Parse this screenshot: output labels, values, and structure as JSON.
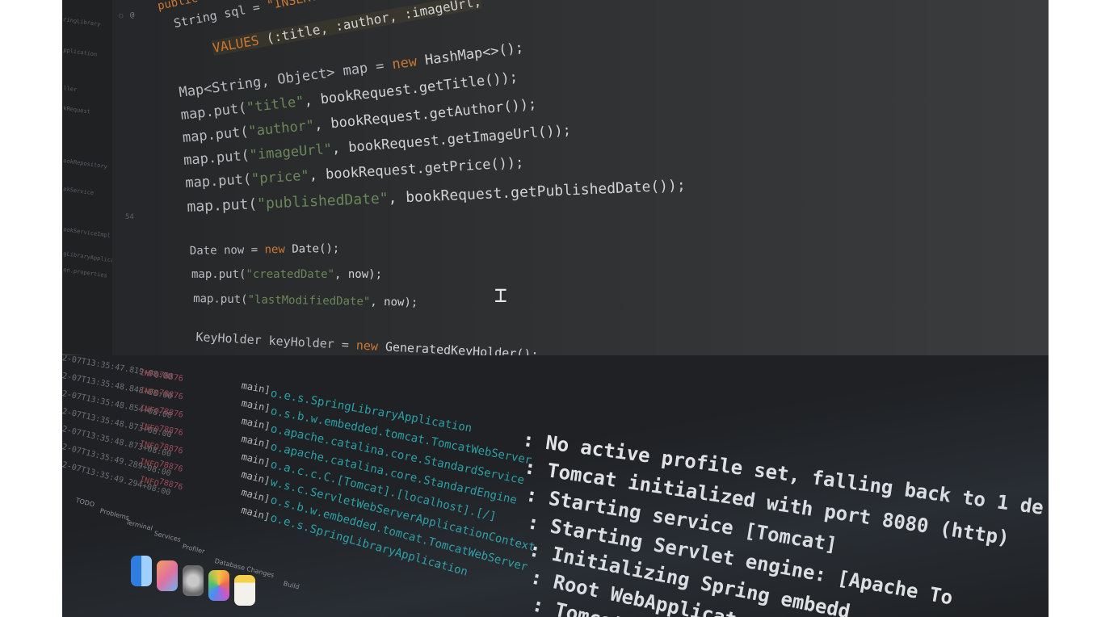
{
  "editor": {
    "sql_line": {
      "prefix": "public Integ",
      "decl": "String sql = ",
      "string": "\"INSERT INTO ",
      "rest": ":imageUrl,"
    },
    "values_line": {
      "kw": "VALUES",
      "text": " (:title, :author, :imageUrl,"
    },
    "gutter_line": "54",
    "lines": [
      {
        "parts": [
          {
            "t": "Map<String, Object> map = ",
            "c": "typ"
          },
          {
            "t": "new",
            "c": "kw"
          },
          {
            "t": " HashMap<>();",
            "c": "txt"
          }
        ]
      },
      {
        "parts": [
          {
            "t": "map.put(",
            "c": "typ"
          },
          {
            "t": "\"title\"",
            "c": "str"
          },
          {
            "t": ", bookRequest.getTitle());",
            "c": "txt"
          }
        ]
      },
      {
        "parts": [
          {
            "t": "map.put(",
            "c": "typ"
          },
          {
            "t": "\"author\"",
            "c": "str"
          },
          {
            "t": ", bookRequest.getAuthor());",
            "c": "txt"
          }
        ]
      },
      {
        "parts": [
          {
            "t": "map.put(",
            "c": "typ"
          },
          {
            "t": "\"imageUrl\"",
            "c": "str"
          },
          {
            "t": ", bookRequest.getImageUrl());",
            "c": "txt"
          }
        ]
      },
      {
        "parts": [
          {
            "t": "map.put(",
            "c": "typ"
          },
          {
            "t": "\"price\"",
            "c": "str"
          },
          {
            "t": ", bookRequest.getPrice());",
            "c": "txt"
          }
        ]
      },
      {
        "parts": [
          {
            "t": "map.put(",
            "c": "typ"
          },
          {
            "t": "\"publishedDate\"",
            "c": "str"
          },
          {
            "t": ", bookRequest.getPublishedDate());",
            "c": "txt"
          }
        ]
      },
      {
        "parts": [
          {
            "t": "Date now = ",
            "c": "typ"
          },
          {
            "t": "new",
            "c": "kw"
          },
          {
            "t": " Date();",
            "c": "txt"
          }
        ]
      },
      {
        "parts": [
          {
            "t": "map.put(",
            "c": "typ"
          },
          {
            "t": "\"createdDate\"",
            "c": "str"
          },
          {
            "t": ", now);",
            "c": "txt"
          }
        ]
      },
      {
        "parts": [
          {
            "t": "map.put(",
            "c": "typ"
          },
          {
            "t": "\"lastModifiedDate\"",
            "c": "str"
          },
          {
            "t": ", now);",
            "c": "txt"
          }
        ]
      },
      {
        "parts": [
          {
            "t": "KeyHolder keyHolder = ",
            "c": "typ"
          },
          {
            "t": "new",
            "c": "kw"
          },
          {
            "t": " GeneratedKeyHolder();",
            "c": "txt"
          }
        ]
      }
    ]
  },
  "project_tree": {
    "items": [
      "ringLibrary",
      "pplication",
      "ller",
      "kRequest",
      "ookRepository",
      "okService",
      "ookServiceImpl",
      "gLibraryApplication",
      "on.properties"
    ]
  },
  "console": {
    "rows": [
      {
        "ts": "2-07T13:35:47.819+08:00",
        "lvl": "INFO",
        "pid": "78876",
        "thread": "main]",
        "logger": "o.e.s.SpringLibraryApplication",
        "message": ": No active profile set, falling back to 1 de"
      },
      {
        "ts": "2-07T13:35:48.848+08:00",
        "lvl": "INFO",
        "pid": "78876",
        "thread": "main]",
        "logger": "o.s.b.w.embedded.tomcat.TomcatWebServer",
        "message": ": Tomcat initialized with port 8080 (http)"
      },
      {
        "ts": "2-07T13:35:48.854+08:00",
        "lvl": "INFO",
        "pid": "78876",
        "thread": "main]",
        "logger": "o.apache.catalina.core.StandardService",
        "message": ": Starting service [Tomcat]"
      },
      {
        "ts": "2-07T13:35:48.873+08:00",
        "lvl": "INFO",
        "pid": "78876",
        "thread": "main]",
        "logger": "o.apache.catalina.core.StandardEngine",
        "message": ": Starting Servlet engine: [Apache To"
      },
      {
        "ts": "2-07T13:35:48.873+08:00",
        "lvl": "INFO",
        "pid": "78876",
        "thread": "main]",
        "logger": "o.a.c.c.C.[Tomcat].[localhost].[/]",
        "message": ": Initializing Spring embedd"
      },
      {
        "ts": "2-07T13:35:49.289+08:00",
        "lvl": "INFO",
        "pid": "78876",
        "thread": "main]",
        "logger": "w.s.c.ServletWebServerApplicationContext",
        "message": ": Root WebApplicat"
      },
      {
        "ts": "2-07T13:35:49.294+08:00",
        "lvl": "INFO",
        "pid": "78876",
        "thread": "main]",
        "logger": "o.s.b.w.embedded.tomcat.TomcatWebServer",
        "message": ": Tomcat"
      },
      {
        "ts": "",
        "lvl": "",
        "pid": "",
        "thread": "main]",
        "logger": "o.e.s.SpringLibraryApplication",
        "message": ""
      }
    ]
  },
  "bottom_tabs": [
    "TODO",
    "Problems",
    "Terminal",
    "Services",
    "Profiler",
    "Database Changes",
    "Build"
  ],
  "dock_icons": [
    "finder-icon",
    "launchpad-icon",
    "system-preferences-icon",
    "photos-icon",
    "notes-icon"
  ],
  "colors": {
    "keyword": "#cc7832",
    "string": "#6a8759",
    "logger": "#2aa0a6",
    "message": "#e2e3e4"
  }
}
